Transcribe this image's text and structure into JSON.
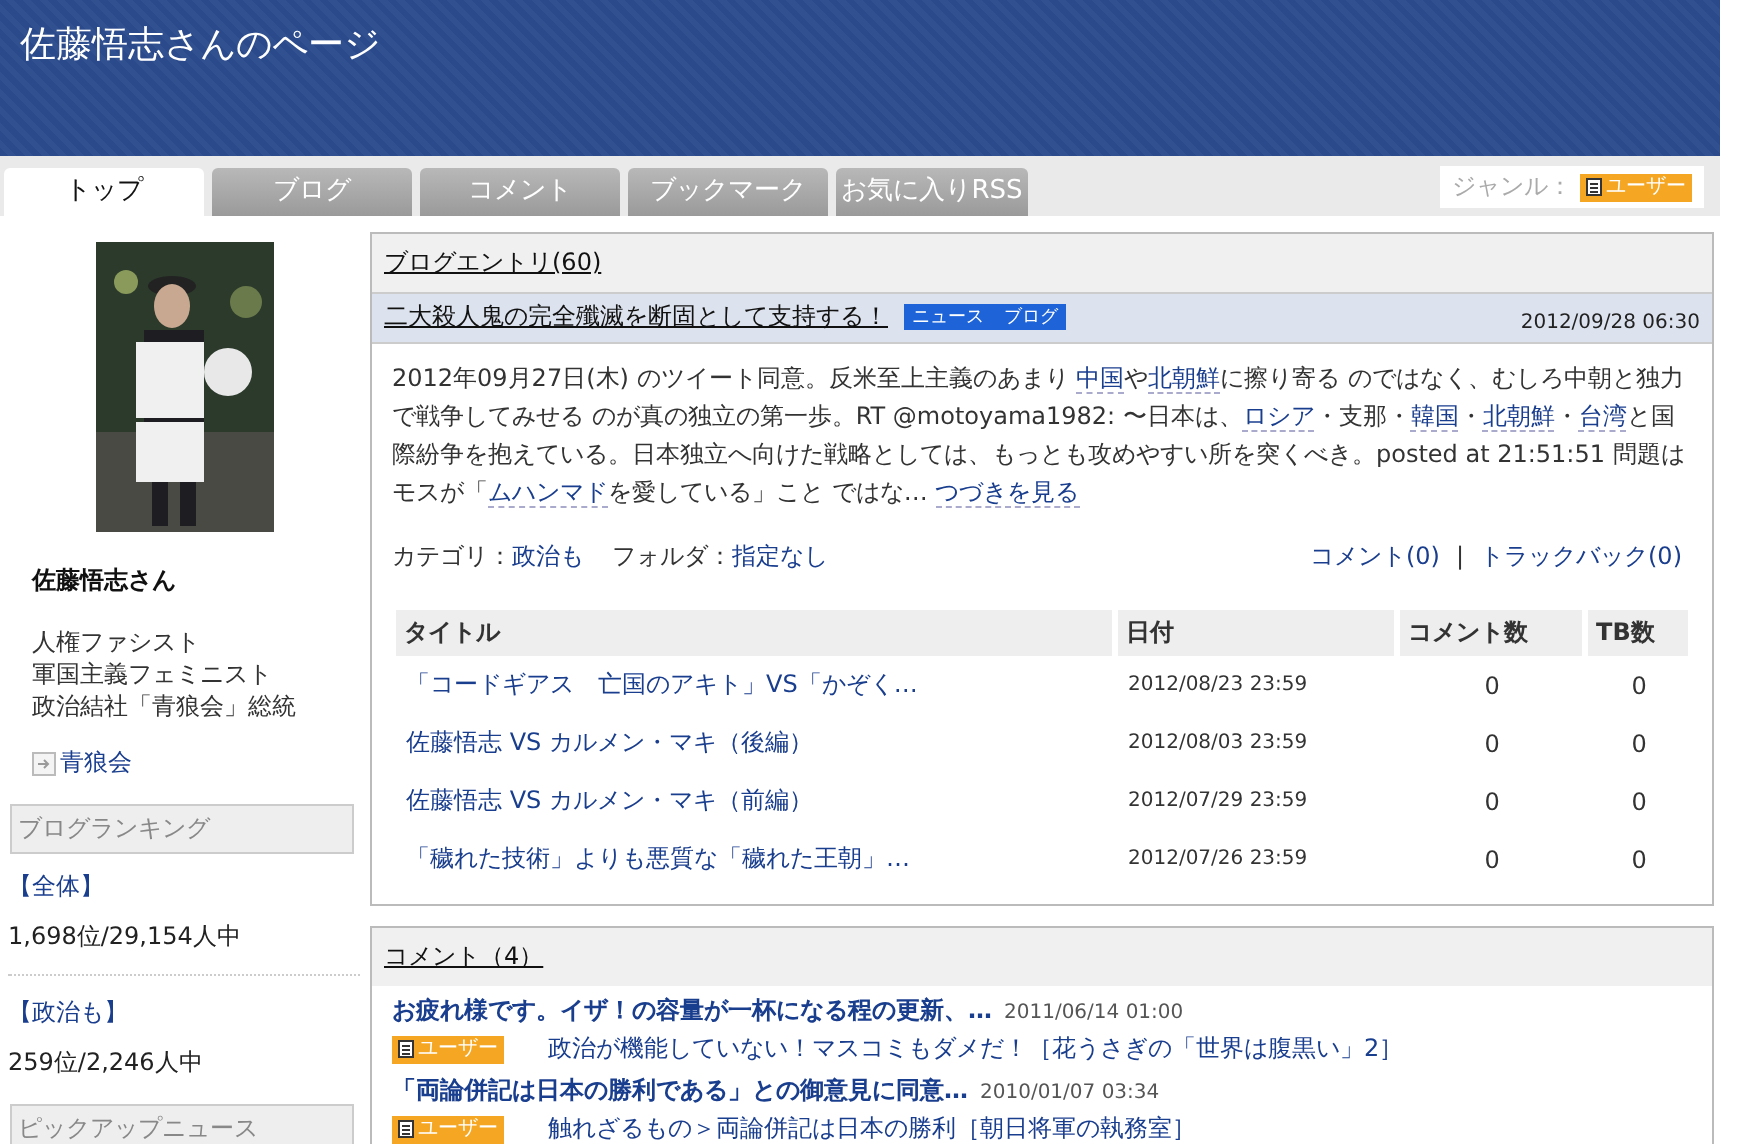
{
  "header": {
    "title": "佐藤悟志さんのページ"
  },
  "tabs": [
    {
      "label": "トップ",
      "selected": true
    },
    {
      "label": "ブログ",
      "selected": false
    },
    {
      "label": "コメント",
      "selected": false
    },
    {
      "label": "ブックマーク",
      "selected": false
    },
    {
      "label": "お気に入りRSS",
      "selected": false
    }
  ],
  "genre": {
    "label": "ジャンル：",
    "badge": "ユーザー"
  },
  "profile": {
    "name": "佐藤悟志さん",
    "description": [
      "人権ファシスト",
      "軍国主義フェミニスト",
      "政治結社「青狼会」総統"
    ],
    "link": "青狼会"
  },
  "ranking": {
    "title": "ブログランキング",
    "entries": [
      {
        "label": "【全体】",
        "rank": "1,698位/29,154人中"
      },
      {
        "label": "【政治も】",
        "rank": "259位/2,246人中"
      }
    ]
  },
  "pickup": {
    "title": "ピックアップニュース"
  },
  "blog": {
    "heading": "ブログエントリ(60)",
    "post": {
      "title": "二大殺人鬼の完全殲滅を断固として支持する！",
      "tags": [
        "ニュース",
        "ブログ"
      ],
      "date": "2012/09/28 06:30",
      "body": [
        {
          "text": "2012年09月27日(木) のツイート同意。反米至上主義のあまり ",
          "link": false
        },
        {
          "text": "中国",
          "link": true
        },
        {
          "text": "や",
          "link": false
        },
        {
          "text": "北朝鮮",
          "link": true
        },
        {
          "text": "に擦り寄る のではなく、むしろ中朝と独力で戦争してみせる のが真の独立の第一歩。RT @motoyama1982: 〜日本は、",
          "link": false
        },
        {
          "text": "ロシア",
          "link": true
        },
        {
          "text": "・支那・",
          "link": false
        },
        {
          "text": "韓国",
          "link": true
        },
        {
          "text": "・",
          "link": false
        },
        {
          "text": "北朝鮮",
          "link": true
        },
        {
          "text": "・",
          "link": false
        },
        {
          "text": "台湾",
          "link": true
        },
        {
          "text": "と国際紛争を抱えている。日本独立へ向けた戦略としては、もっとも攻めやすい所を突くべき。posted at 21:51:51 問題はモスが「",
          "link": false
        },
        {
          "text": "ムハンマド",
          "link": true
        },
        {
          "text": "を愛している」こと ではな… ",
          "link": false
        },
        {
          "text": "つづきを見る",
          "link": true
        }
      ],
      "category_label": "カテゴリ：",
      "category": "政治も",
      "folder_label": "フォルダ：",
      "folder": "指定なし",
      "comments": "コメント(0)",
      "separator": "|",
      "trackbacks": "トラックバック(0)"
    },
    "table": {
      "columns": [
        "タイトル",
        "日付",
        "コメント数",
        "TB数"
      ],
      "rows": [
        {
          "title": "「コードギアス　亡国のアキト」VS「かぞく…",
          "date": "2012/08/23 23:59",
          "comments": "0",
          "tb": "0"
        },
        {
          "title": "佐藤悟志 VS カルメン・マキ（後編）",
          "date": "2012/08/03 23:59",
          "comments": "0",
          "tb": "0"
        },
        {
          "title": "佐藤悟志 VS カルメン・マキ（前編）",
          "date": "2012/07/29 23:59",
          "comments": "0",
          "tb": "0"
        },
        {
          "title": "「穢れた技術」よりも悪質な「穢れた王朝」…",
          "date": "2012/07/26 23:59",
          "comments": "0",
          "tb": "0"
        }
      ]
    }
  },
  "comments": {
    "heading": "コメント（4）",
    "items": [
      {
        "title": "お疲れ様です。イザ！の容量が一杯になる程の更新、…",
        "date": "2011/06/14 01:00",
        "badge": "ユーザー",
        "source": "政治が機能していない！マスコミもダメだ！［花うさぎの「世界は腹黒い」2］"
      },
      {
        "title": "「両論併記は日本の勝利である」との御意見に同意…",
        "date": "2010/01/07 03:34",
        "badge": "ユーザー",
        "source": "触れざるもの＞両論併記は日本の勝利［朝日将軍の執務室］"
      }
    ]
  }
}
